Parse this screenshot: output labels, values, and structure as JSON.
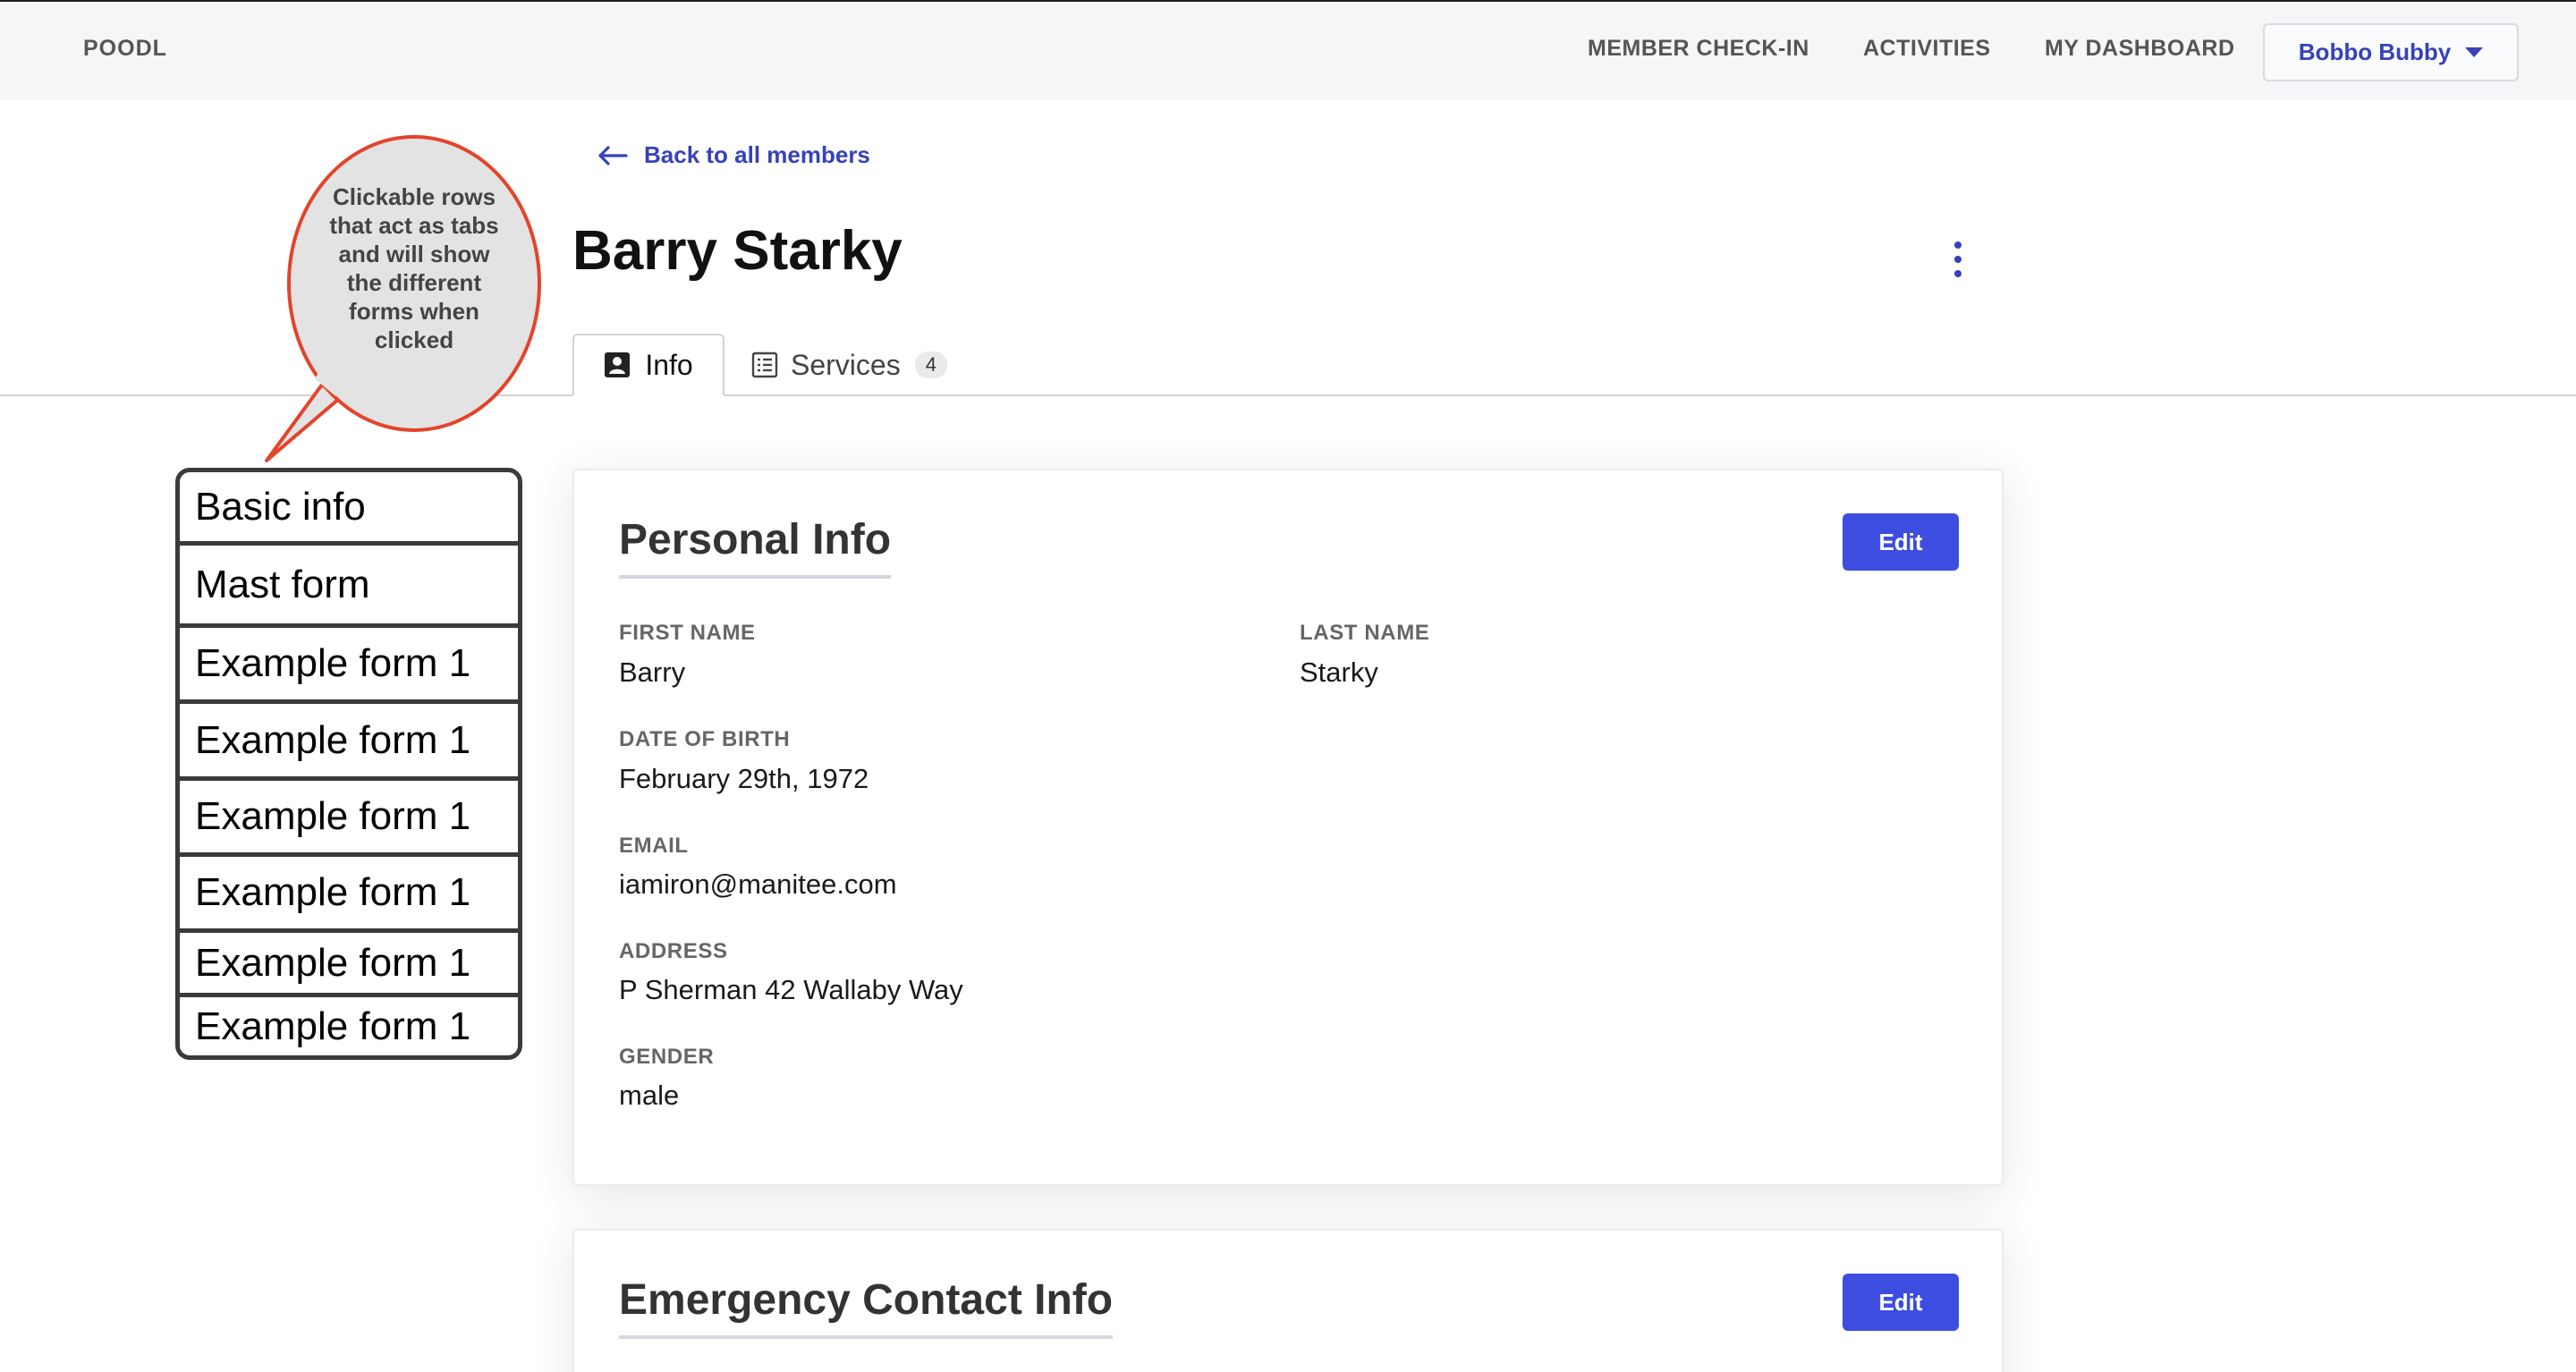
{
  "nav": {
    "brand": "POODL",
    "links": [
      "MEMBER CHECK-IN",
      "ACTIVITIES",
      "MY DASHBOARD"
    ],
    "user": "Bobbo Bubby"
  },
  "header": {
    "back_label": "Back to all members",
    "member_name": "Barry Starky",
    "tabs": [
      {
        "label": "Info",
        "icon": "contact-card-icon"
      },
      {
        "label": "Services",
        "icon": "list-icon",
        "count": "4"
      }
    ]
  },
  "personal": {
    "title": "Personal Info",
    "edit_label": "Edit",
    "fields": {
      "first_name": {
        "label": "FIRST NAME",
        "value": "Barry"
      },
      "last_name": {
        "label": "LAST NAME",
        "value": "Starky"
      },
      "dob": {
        "label": "DATE OF BIRTH",
        "value": "February 29th, 1972"
      },
      "email": {
        "label": "EMAIL",
        "value": "iamiron@manitee.com"
      },
      "address": {
        "label": "ADDRESS",
        "value": "P Sherman 42 Wallaby Way"
      },
      "gender": {
        "label": "GENDER",
        "value": "male"
      }
    }
  },
  "emergency": {
    "title": "Emergency Contact Info",
    "edit_label": "Edit"
  },
  "annotation": {
    "callout": "Clickable rows that act as tabs and will show the different forms when clicked",
    "rows": [
      "Basic info",
      "Mast form",
      "Example form 1",
      "Example form 1",
      "Example form 1",
      "Example form 1",
      "Example form 1",
      "Example form 1"
    ]
  },
  "colors": {
    "accent": "#3d4de0",
    "link": "#3742b8",
    "callout_border": "#e3442b",
    "callout_fill": "#e3e3e3"
  }
}
